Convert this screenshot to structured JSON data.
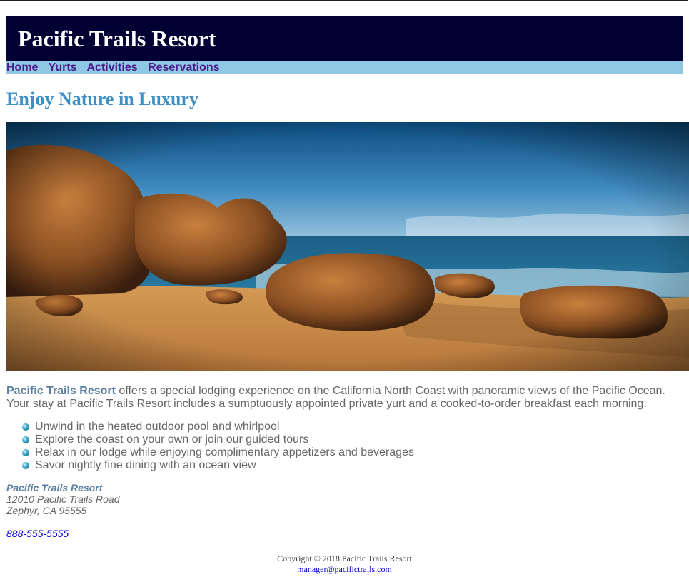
{
  "header": {
    "title": "Pacific Trails Resort"
  },
  "nav": {
    "items": [
      "Home",
      "Yurts",
      "Activities",
      "Reservations"
    ]
  },
  "main": {
    "heading": "Enjoy Nature in Luxury",
    "intro_brand": "Pacific Trails Resort",
    "intro_text": " offers a special lodging experience on the California North Coast with panoramic views of the Pacific Ocean. Your stay at Pacific Trails Resort includes a sumptuously appointed private yurt and a cooked-to-order breakfast each morning.",
    "features": [
      "Unwind in the heated outdoor pool and whirlpool",
      "Explore the coast on your own or join our guided tours",
      "Relax in our lodge while enjoying complimentary appetizers and beverages",
      "Savor nightly fine dining with an ocean view"
    ],
    "address": {
      "name": "Pacific Trails Resort",
      "street": "12010 Pacific Trails Road",
      "city": "Zephyr, CA 95555"
    },
    "phone": "888-555-5555"
  },
  "footer": {
    "copyright": "Copyright © 2018 Pacific Trails Resort",
    "email": "manager@pacifictrails.com"
  },
  "colors": {
    "header_bg": "#000033",
    "nav_bg": "#90c7e3",
    "nav_link": "#4b1c8c",
    "heading": "#3d8fc4"
  }
}
